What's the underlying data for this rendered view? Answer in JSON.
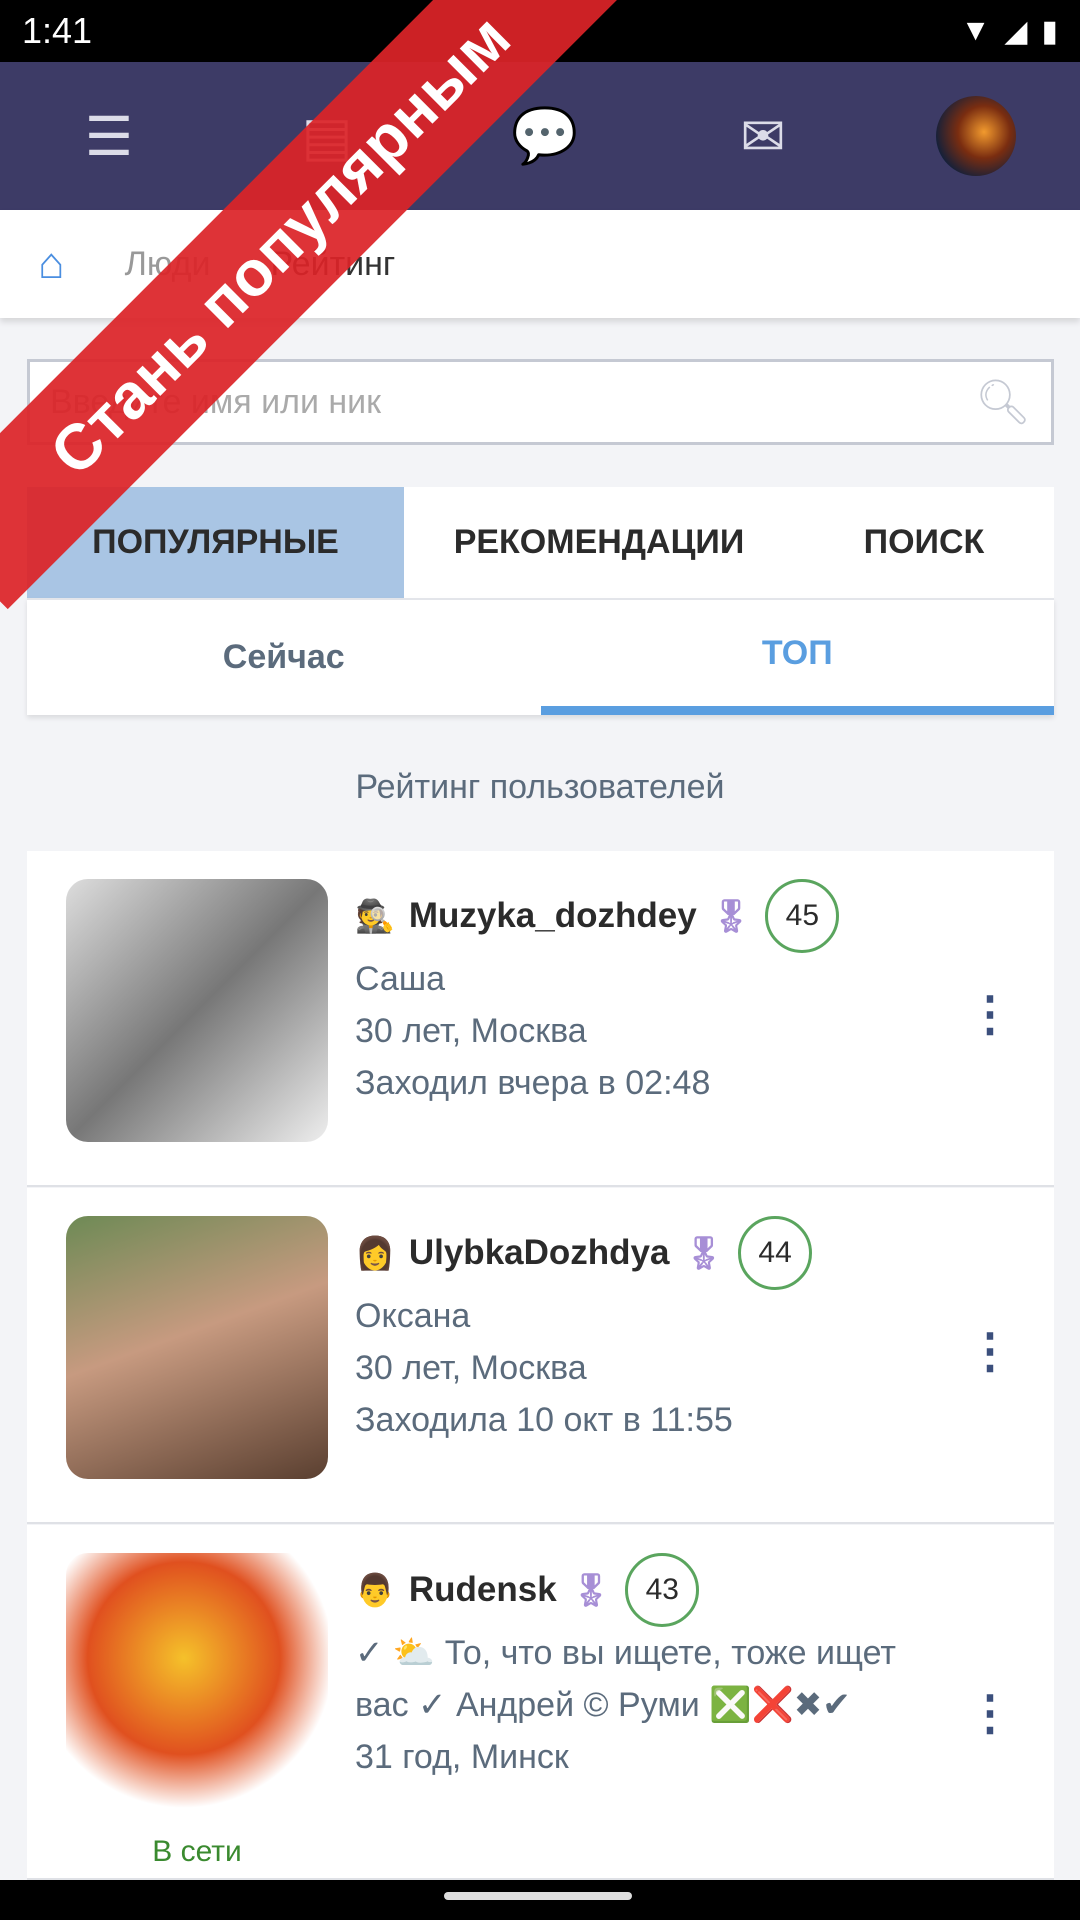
{
  "status": {
    "time": "1:41"
  },
  "nav": {
    "icons": [
      "menu-icon",
      "news-icon",
      "chat-icon",
      "mail-icon",
      "profile-avatar"
    ]
  },
  "breadcrumb": {
    "home": "home-icon",
    "people": "Люди",
    "current": "Рейтинг"
  },
  "search": {
    "placeholder": "Введите имя или ник",
    "value": ""
  },
  "tabs": [
    "ПОПУЛЯРНЫЕ",
    "РЕКОМЕНДАЦИИ",
    "ПОИСК"
  ],
  "subtabs": [
    "Сейчас",
    "ТОП"
  ],
  "heading": "Рейтинг пользователей",
  "users": [
    {
      "name": "Muzyka_dozhdey",
      "score": "45",
      "lines": [
        "Саша",
        "30 лет, Москва",
        "Заходил вчера в 02:48"
      ]
    },
    {
      "name": "UlybkaDozhdya",
      "score": "44",
      "lines": [
        "Оксана",
        "30 лет, Москва",
        "Заходила 10 окт в 11:55"
      ]
    },
    {
      "name": "Rudensk",
      "score": "43",
      "lines": [
        "✓ ⛅ То, что вы ищете, тоже ищет",
        "вас ✓ Андрей © Руми ❎❌✖✔",
        "31 год, Минск"
      ],
      "status": "В сети"
    }
  ],
  "banner": "Стань популярным",
  "colors": {
    "nav": "#3d3b66",
    "accent": "#5a9ee0",
    "activeTab": "#a9c5e4",
    "score": "#5aa55e",
    "banner": "#dc2328"
  }
}
